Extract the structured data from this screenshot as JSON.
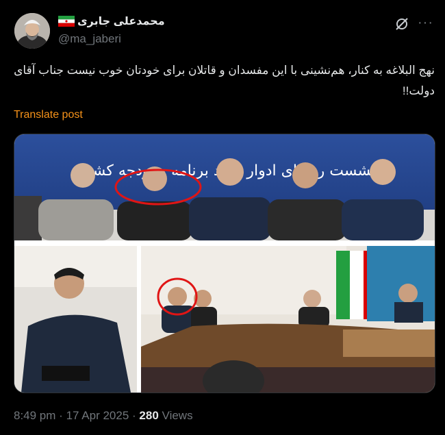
{
  "author": {
    "display_name": "محمدعلی جابری",
    "handle": "@ma_jaberi"
  },
  "post": {
    "text": "نهج البلاغه به کنار، هم‌نشینی با این مفسدان و قاتلان برای خودتان خوب نیست جناب آقای دولت!!",
    "translate_label": "Translate post"
  },
  "media": {
    "banner_text": "نشست روسای ادوار ستاد برنامه و بودجه کشور"
  },
  "meta": {
    "time": "8:49 pm",
    "separator1": "·",
    "date": "17 Apr 2025",
    "separator2": "·",
    "views_count": "280",
    "views_label": "Views"
  },
  "icons": [
    "iran-flag-icon",
    "grok-icon",
    "more-icon"
  ],
  "colors": {
    "background": "#000000",
    "text": "#e7e9ea",
    "muted": "#71767b",
    "translate": "#f7931a"
  }
}
